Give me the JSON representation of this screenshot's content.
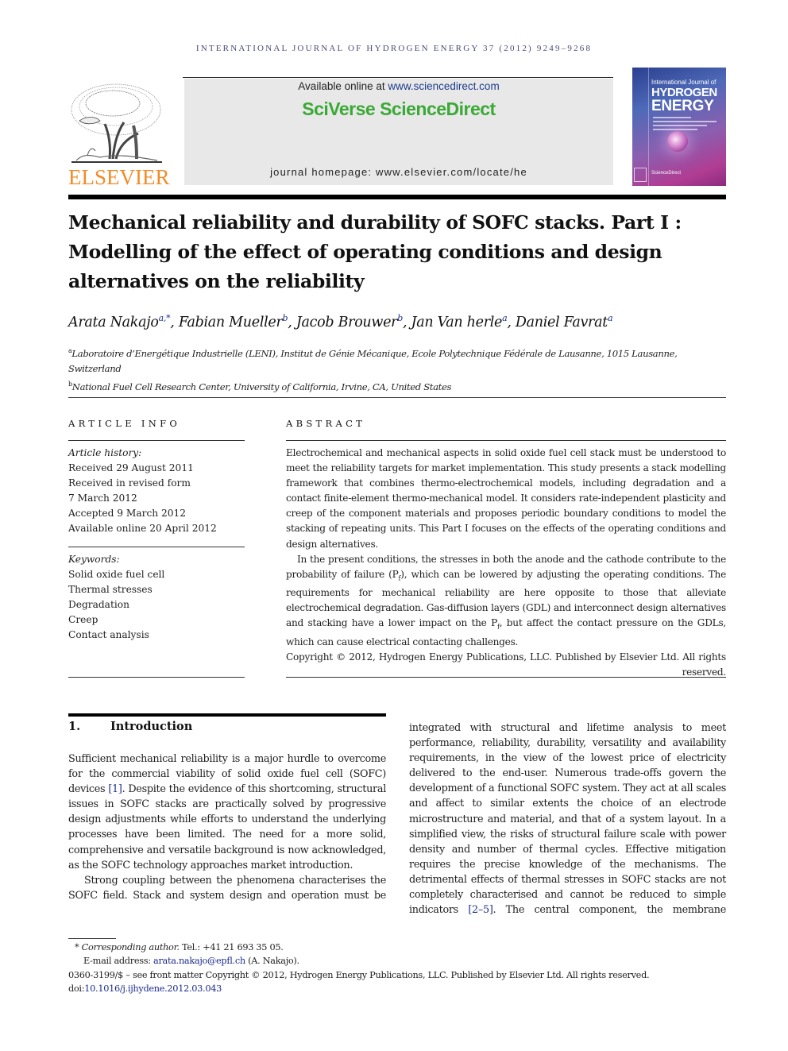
{
  "running_head": "INTERNATIONAL JOURNAL OF HYDROGEN ENERGY 37 (2012) 9249–9268",
  "masthead": {
    "publisher_logo_text": "ELSEVIER",
    "available_prefix": "Available online at ",
    "available_link": "www.sciencedirect.com",
    "platform_name": "SciVerse ScienceDirect",
    "homepage_prefix": "journal homepage: ",
    "homepage_link": "www.elsevier.com/locate/he",
    "cover": {
      "line1": "International Journal of",
      "line2": "HYDROGEN",
      "line3": "ENERGY",
      "footer": "ScienceDirect"
    },
    "colors": {
      "elsevier_orange": "#f28c28",
      "sciverse_green": "#3aa935",
      "link_blue": "#1c3c8c"
    }
  },
  "article": {
    "title": "Mechanical reliability and durability of SOFC stacks. Part I : Modelling of the effect of operating conditions and design alternatives on the reliability",
    "authors": [
      {
        "name": "Arata Nakajo",
        "sup": "a,*",
        "sep": ", "
      },
      {
        "name": "Fabian Mueller",
        "sup": "b",
        "sep": ", "
      },
      {
        "name": "Jacob Brouwer",
        "sup": "b",
        "sep": ", "
      },
      {
        "name": "Jan Van herle",
        "sup": "a",
        "sep": ", "
      },
      {
        "name": "Daniel Favrat",
        "sup": "a",
        "sep": ""
      }
    ],
    "affiliations": [
      {
        "label": "a",
        "text": "Laboratoire d’Energétique Industrielle (LENI), Institut de Génie Mécanique, Ecole Polytechnique Fédérale de Lausanne, 1015 Lausanne, Switzerland"
      },
      {
        "label": "b",
        "text": "National Fuel Cell Research Center, University of California, Irvine, CA, United States"
      }
    ]
  },
  "article_info": {
    "heading": "ARTICLE INFO",
    "history_label": "Article history:",
    "history": [
      "Received 29 August 2011",
      "Received in revised form",
      "7 March 2012",
      "Accepted 9 March 2012",
      "Available online 20 April 2012"
    ],
    "keywords_label": "Keywords:",
    "keywords": [
      "Solid oxide fuel cell",
      "Thermal stresses",
      "Degradation",
      "Creep",
      "Contact analysis"
    ]
  },
  "abstract": {
    "heading": "ABSTRACT",
    "p1": "Electrochemical and mechanical aspects in solid oxide fuel cell stack must be understood to meet the reliability targets for market implementation. This study presents a stack modelling framework that combines thermo-electrochemical models, including degradation and a contact finite-element thermo-mechanical model. It considers rate-independent plasticity and creep of the component materials and proposes periodic boundary conditions to model the stacking of repeating units. This Part I focuses on the effects of the operating conditions and design alternatives.",
    "p2_a": "In the present conditions, the stresses in both the anode and the cathode contribute to the probability of failure (P",
    "p2_sub1": "f",
    "p2_b": "), which can be lowered by adjusting the operating conditions. The requirements for mechanical reliability are here opposite to those that alleviate electrochemical degradation. Gas-diffusion layers (GDL) and interconnect design alternatives and stacking have a lower impact on the P",
    "p2_sub2": "f",
    "p2_c": ", but affect the contact pressure on the GDLs, which can cause electrical contacting challenges.",
    "copyright": "Copyright © 2012, Hydrogen Energy Publications, LLC. Published by Elsevier Ltd. All rights reserved."
  },
  "introduction": {
    "number": "1.",
    "heading": "Introduction",
    "left_p1_a": "Sufficient mechanical reliability is a major hurdle to overcome for the commercial viability of solid oxide fuel cell (SOFC) devices ",
    "left_p1_ref": "[1]",
    "left_p1_b": ". Despite the evidence of this shortcoming, structural issues in SOFC stacks are practically solved by progressive design adjustments while efforts to understand the underlying processes have been limited. The need for a more solid, comprehensive and versatile background is now acknowledged, as the SOFC technology approaches market introduction.",
    "left_p2": "Strong coupling between the phenomena characterises the SOFC field. Stack and system design and operation must be",
    "right_a": "integrated with structural and lifetime analysis to meet performance, reliability, durability, versatility and availability requirements, in the view of the lowest price of electricity delivered to the end-user. Numerous trade-offs govern the development of a functional SOFC system. They act at all scales and affect to similar extents the choice of an electrode microstructure and material, and that of a system layout. In a simplified view, the risks of structural failure scale with power density and number of thermal cycles. Effective mitigation requires the precise knowledge of the mechanisms. The detrimental effects of thermal stresses in SOFC stacks are not completely characterised and cannot be reduced to simple indicators ",
    "right_ref": "[2–5]",
    "right_b": ". The central component, the membrane"
  },
  "footnotes": {
    "star": "*",
    "corr_label": "Corresponding author.",
    "tel": " Tel.: +41 21 693 35 05.",
    "email_prefix": "E-mail address: ",
    "email": "arata.nakajo@epfl.ch",
    "email_suffix": " (A. Nakajo).",
    "front_matter": "0360-3199/$ – see front matter Copyright © 2012, Hydrogen Energy Publications, LLC. Published by Elsevier Ltd. All rights reserved.",
    "doi_prefix": "doi:",
    "doi": "10.1016/j.ijhydene.2012.03.043"
  }
}
